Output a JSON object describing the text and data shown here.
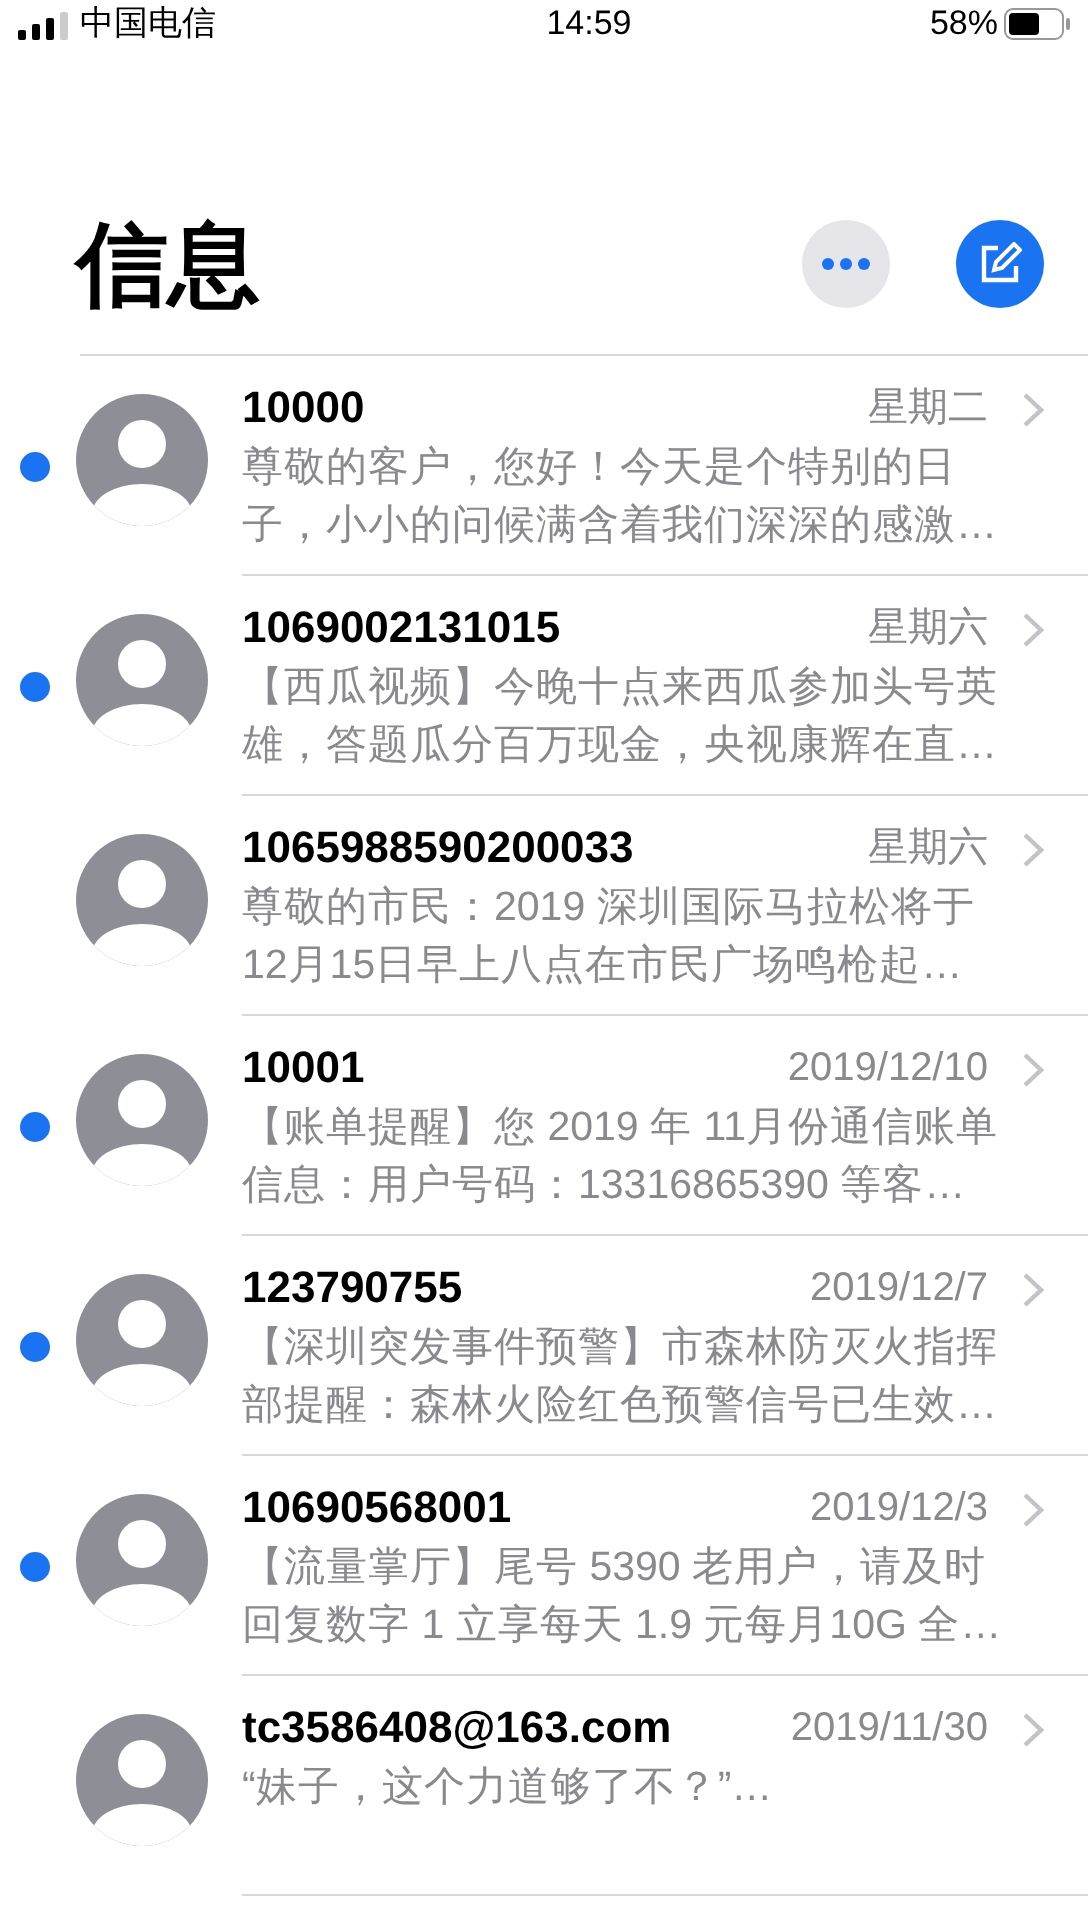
{
  "status_bar": {
    "carrier": "中国电信",
    "time": "14:59",
    "battery": "58%"
  },
  "title": "信息",
  "conversations": [
    {
      "name": "10000",
      "date": "星期二",
      "unread": true,
      "preview": [
        "尊敬的客户，您好！今天是个特别的日",
        "子，小小的问候满含着我们深深的感激…"
      ]
    },
    {
      "name": "1069002131015",
      "date": "星期六",
      "unread": true,
      "preview": [
        "【西瓜视频】今晚十点来西瓜参加头号英",
        "雄，答题瓜分百万现金，央视康辉在直…"
      ]
    },
    {
      "name": "1065988590200033",
      "date": "星期六",
      "unread": false,
      "preview": [
        "尊敬的市民：2019 深圳国际马拉松将于",
        "12月15日早上八点在市民广场鸣枪起…"
      ]
    },
    {
      "name": "10001",
      "date": "2019/12/10",
      "unread": true,
      "preview": [
        "【账单提醒】您 2019 年 11月份通信账单",
        "信息：用户号码：13316865390 等客…"
      ]
    },
    {
      "name": "123790755",
      "date": "2019/12/7",
      "unread": true,
      "preview": [
        "【深圳突发事件预警】市森林防灭火指挥",
        "部提醒：森林火险红色预警信号已生效…"
      ]
    },
    {
      "name": "10690568001",
      "date": "2019/12/3",
      "unread": true,
      "preview": [
        "【流量掌厅】尾号 5390 老用户，请及时",
        "回复数字 1 立享每天 1.9 元每月10G 全…"
      ]
    },
    {
      "name": "tc3586408@163.com",
      "date": "2019/11/30",
      "unread": false,
      "preview": [
        "“妹子，这个力道够了不？”…"
      ]
    }
  ]
}
